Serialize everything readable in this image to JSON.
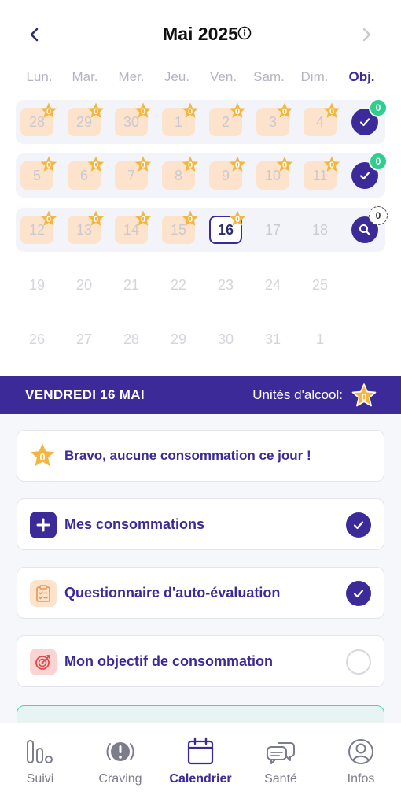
{
  "calendar": {
    "month_title": "Mai 2025",
    "weekdays": [
      "Lun.",
      "Mar.",
      "Mer.",
      "Jeu.",
      "Ven.",
      "Sam.",
      "Dim."
    ],
    "objective_label": "Obj.",
    "weeks": [
      {
        "days": [
          "28",
          "29",
          "30",
          "1",
          "2",
          "3",
          "4"
        ],
        "stars": [
          "0",
          "0",
          "0",
          "0",
          "0",
          "0",
          "0"
        ],
        "objective_count": "0"
      },
      {
        "days": [
          "5",
          "6",
          "7",
          "8",
          "9",
          "10",
          "11"
        ],
        "stars": [
          "0",
          "0",
          "0",
          "0",
          "0",
          "0",
          "0"
        ],
        "objective_count": "0"
      },
      {
        "days": [
          "12",
          "13",
          "14",
          "15",
          "16",
          "17",
          "18"
        ],
        "stars": [
          "0",
          "0",
          "0",
          "0",
          "0"
        ],
        "objective_count": "0"
      },
      {
        "days": [
          "19",
          "20",
          "21",
          "22",
          "23",
          "24",
          "25"
        ]
      },
      {
        "days": [
          "26",
          "27",
          "28",
          "29",
          "30",
          "31",
          "1"
        ]
      }
    ],
    "selected_day": "16"
  },
  "date_bar": {
    "day_label": "VENDREDI 16 MAI",
    "units_label": "Unités d'alcool:",
    "units_value": "0"
  },
  "cards": [
    {
      "label": "Bravo, aucune consommation ce jour !",
      "star_value": "0",
      "icon": "star-icon",
      "checked": false
    },
    {
      "label": "Mes consommations",
      "icon": "plus-icon",
      "checked": true
    },
    {
      "label": "Questionnaire d'auto-évaluation",
      "icon": "clipboard-icon",
      "checked": true
    },
    {
      "label": "Mon objectif de consommation",
      "icon": "target-icon",
      "checked": false
    }
  ],
  "tabs": [
    {
      "label": "Suivi",
      "icon": "chart-bars-icon"
    },
    {
      "label": "Craving",
      "icon": "alert-circle-icon"
    },
    {
      "label": "Calendrier",
      "icon": "calendar-icon",
      "active": true
    },
    {
      "label": "Santé",
      "icon": "chat-bubbles-icon"
    },
    {
      "label": "Infos",
      "icon": "user-icon"
    }
  ],
  "colors": {
    "primary": "#3c2a98",
    "star": "#f4b63f",
    "day_bg": "#fde3cc",
    "success": "#2fce8e"
  }
}
